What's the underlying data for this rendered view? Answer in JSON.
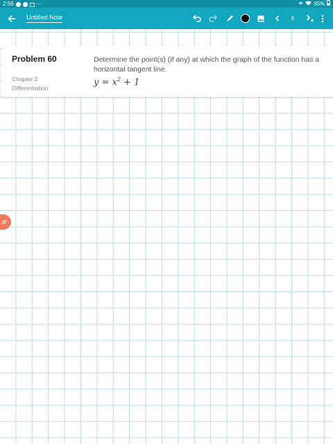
{
  "status": {
    "time": "2:56",
    "more": "···",
    "battery": "35%"
  },
  "toolbar": {
    "title": "Untitled Note",
    "page_number": "6",
    "ink_color": "#000000",
    "icons": [
      "back-arrow-icon",
      "undo-icon",
      "redo-icon",
      "pen-icon",
      "color-icon",
      "image-icon",
      "chevron-left-icon",
      "chevron-right-icon",
      "more-vert-icon"
    ]
  },
  "problem": {
    "title": "Problem 60",
    "chapter": "Chapter 2",
    "topic": "Differentiation",
    "question": "Determine the point(s) (if any) at which the graph of the function has a horizontal tangent line.",
    "eq_lhs": "y = x",
    "eq_exp": "2",
    "eq_rhs": " + 1"
  },
  "sidetab": {
    "label": "///"
  },
  "colors": {
    "toolbar": "#13a6bf",
    "statusbar": "#0f8ea4",
    "grid": "#bcdbea",
    "accent": "#ef7a5c"
  }
}
